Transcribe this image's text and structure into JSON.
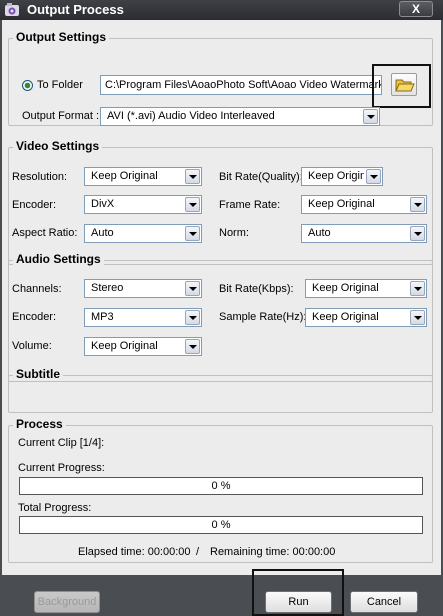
{
  "window": {
    "title": "Output Process",
    "close_label": "X"
  },
  "output_settings": {
    "title": "Output Settings",
    "to_folder_label": "To Folder",
    "folder_path": "C:\\Program Files\\AoaoPhoto Soft\\Aoao Video Watermark Pro",
    "output_format_label": "Output Format :",
    "output_format_value": "AVI  (*.avi) Audio Video Interleaved"
  },
  "video_settings": {
    "title": "Video Settings",
    "resolution_label": "Resolution:",
    "resolution_value": "Keep Original",
    "bitrate_label": "Bit Rate(Quality):",
    "bitrate_value": "Keep Original",
    "encoder_label": "Encoder:",
    "encoder_value": "DivX",
    "framerate_label": "Frame Rate:",
    "framerate_value": "Keep Original",
    "aspect_label": "Aspect Ratio:",
    "aspect_value": "Auto",
    "norm_label": "Norm:",
    "norm_value": "Auto"
  },
  "audio_settings": {
    "title": "Audio Settings",
    "channels_label": "Channels:",
    "channels_value": "Stereo",
    "bitrate_label": "Bit Rate(Kbps):",
    "bitrate_value": "Keep Original",
    "encoder_label": "Encoder:",
    "encoder_value": "MP3",
    "samplerate_label": "Sample Rate(Hz):",
    "samplerate_value": "Keep Original",
    "volume_label": "Volume:",
    "volume_value": "Keep Original"
  },
  "subtitle": {
    "title": "Subtitle"
  },
  "process": {
    "title": "Process",
    "current_clip": "Current Clip [1/4]:",
    "current_progress_label": "Current Progress:",
    "current_progress_text": "0 %",
    "current_progress_value": 0,
    "total_progress_label": "Total Progress:",
    "total_progress_text": "0 %",
    "total_progress_value": 0,
    "elapsed": "Elapsed time: 00:00:00",
    "separator": "/",
    "remaining": "Remaining time: 00:00:00"
  },
  "buttons": {
    "background": "Background",
    "run": "Run",
    "cancel": "Cancel"
  }
}
